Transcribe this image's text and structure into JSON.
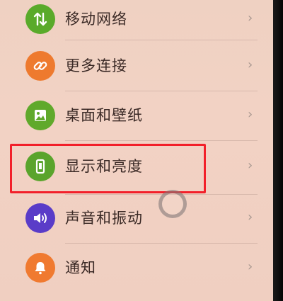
{
  "settings_list": {
    "items": [
      {
        "label": "移动网络",
        "icon": "mobile-network-icon",
        "color": "#5aaa2a",
        "selected": false
      },
      {
        "label": "更多连接",
        "icon": "link-icon",
        "color": "#ee7a2e",
        "selected": false
      },
      {
        "label": "桌面和壁纸",
        "icon": "wallpaper-icon",
        "color": "#60a92b",
        "selected": false
      },
      {
        "label": "显示和亮度",
        "icon": "display-brightness-icon",
        "color": "#5aa42c",
        "selected": true
      },
      {
        "label": "声音和振动",
        "icon": "sound-vibration-icon",
        "color": "#5a3cc8",
        "selected": false
      },
      {
        "label": "通知",
        "icon": "notification-bell-icon",
        "color": "#f07a30",
        "selected": false
      }
    ],
    "chevron": "›"
  },
  "annotation": {
    "highlight_color": "#f2202a"
  }
}
